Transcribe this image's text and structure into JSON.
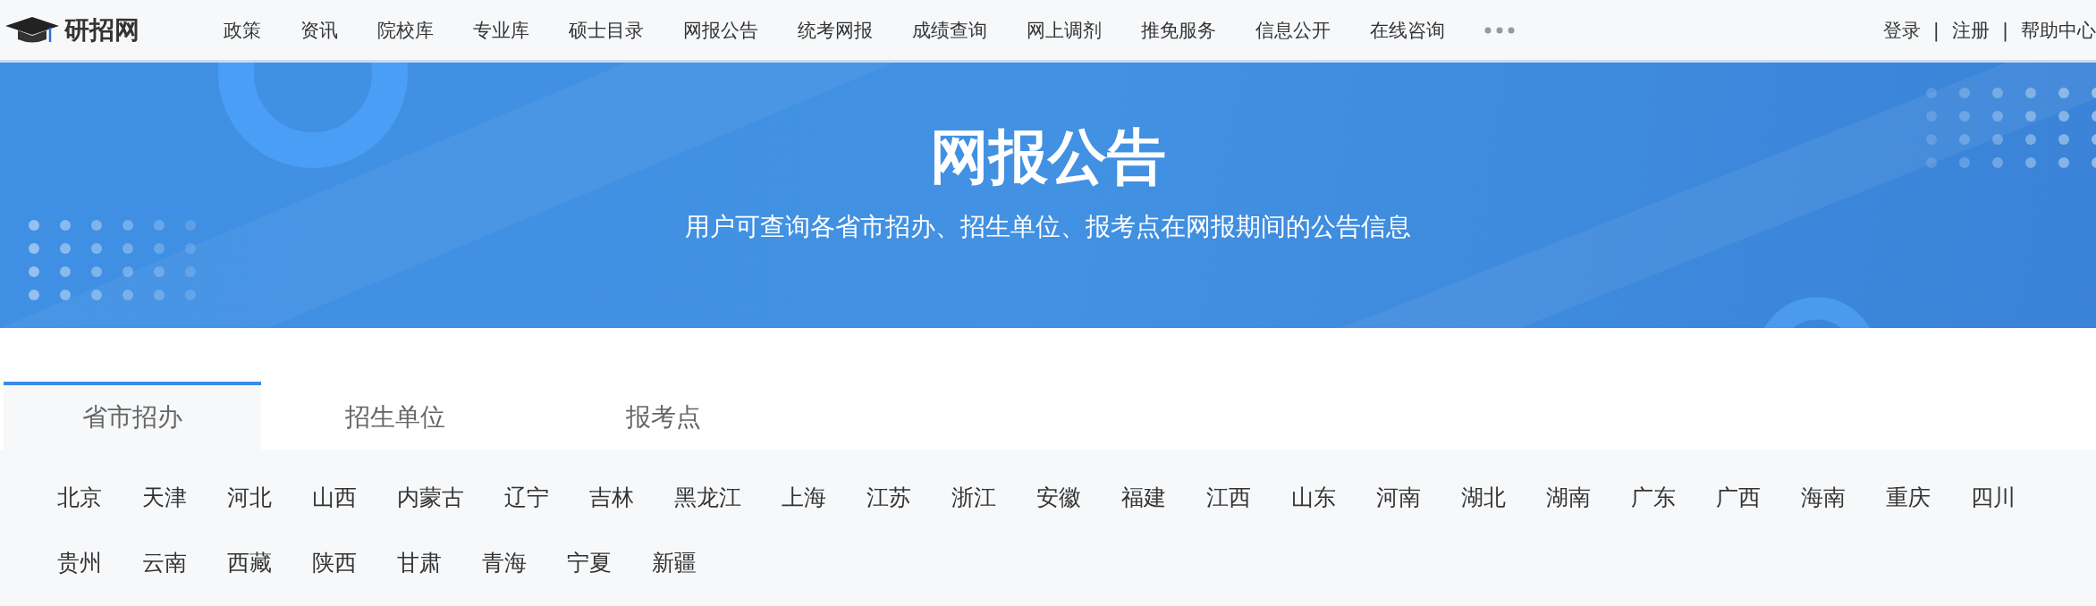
{
  "header": {
    "logo_text": "研招网",
    "nav": [
      {
        "label": "政策",
        "selected": false
      },
      {
        "label": "资讯",
        "selected": false
      },
      {
        "label": "院校库",
        "selected": false
      },
      {
        "label": "专业库",
        "selected": false
      },
      {
        "label": "硕士目录",
        "selected": false
      },
      {
        "label": "网报公告",
        "selected": false
      },
      {
        "label": "统考网报",
        "selected": false
      },
      {
        "label": "成绩查询",
        "selected": false
      },
      {
        "label": "网上调剂",
        "selected": false
      },
      {
        "label": "推免服务",
        "selected": false
      },
      {
        "label": "信息公开",
        "selected": false
      },
      {
        "label": "在线咨询",
        "selected": false
      }
    ],
    "account_links": [
      "登录",
      "注册",
      "帮助中心"
    ],
    "separator": "|"
  },
  "banner": {
    "title": "网报公告",
    "subtitle": "用户可查询各省市招办、招生单位、报考点在网报期间的公告信息"
  },
  "tabs": [
    {
      "label": "省市招办",
      "selected": true
    },
    {
      "label": "招生单位",
      "selected": false
    },
    {
      "label": "报考点",
      "selected": false
    }
  ],
  "provinces": [
    "北京",
    "天津",
    "河北",
    "山西",
    "内蒙古",
    "辽宁",
    "吉林",
    "黑龙江",
    "上海",
    "江苏",
    "浙江",
    "安徽",
    "福建",
    "江西",
    "山东",
    "河南",
    "湖北",
    "湖南",
    "广东",
    "广西",
    "海南",
    "重庆",
    "四川",
    "贵州",
    "云南",
    "西藏",
    "陕西",
    "甘肃",
    "青海",
    "宁夏",
    "新疆"
  ]
}
